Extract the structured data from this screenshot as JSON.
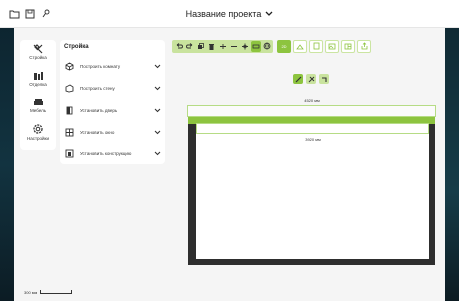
{
  "header": {
    "project_title": "Название проекта"
  },
  "left_menu": {
    "items": [
      {
        "label": "Стройка",
        "icon": "hammer-icon"
      },
      {
        "label": "Отделка",
        "icon": "paint-roller-icon"
      },
      {
        "label": "Мебель",
        "icon": "sofa-icon"
      },
      {
        "label": "Настройки",
        "icon": "gear-icon"
      }
    ]
  },
  "panel": {
    "title": "Стройка",
    "rows": [
      {
        "label": "Построить комнату",
        "icon": "cube-icon"
      },
      {
        "label": "Построить стену",
        "icon": "wall-icon"
      },
      {
        "label": "Установить дверь",
        "icon": "door-icon"
      },
      {
        "label": "Установить окно",
        "icon": "window-icon"
      },
      {
        "label": "Установить конструкцию",
        "icon": "construction-icon"
      }
    ]
  },
  "toolbar": {
    "view_2d": "2D"
  },
  "drawing": {
    "top_dimension": "4520 мм",
    "inner_dimension": "3920 мм"
  },
  "scale": {
    "label": "300 мм"
  },
  "colors": {
    "accent": "#8dc43f",
    "accent_light": "#c9e39e",
    "wall": "#2e2e2e"
  }
}
